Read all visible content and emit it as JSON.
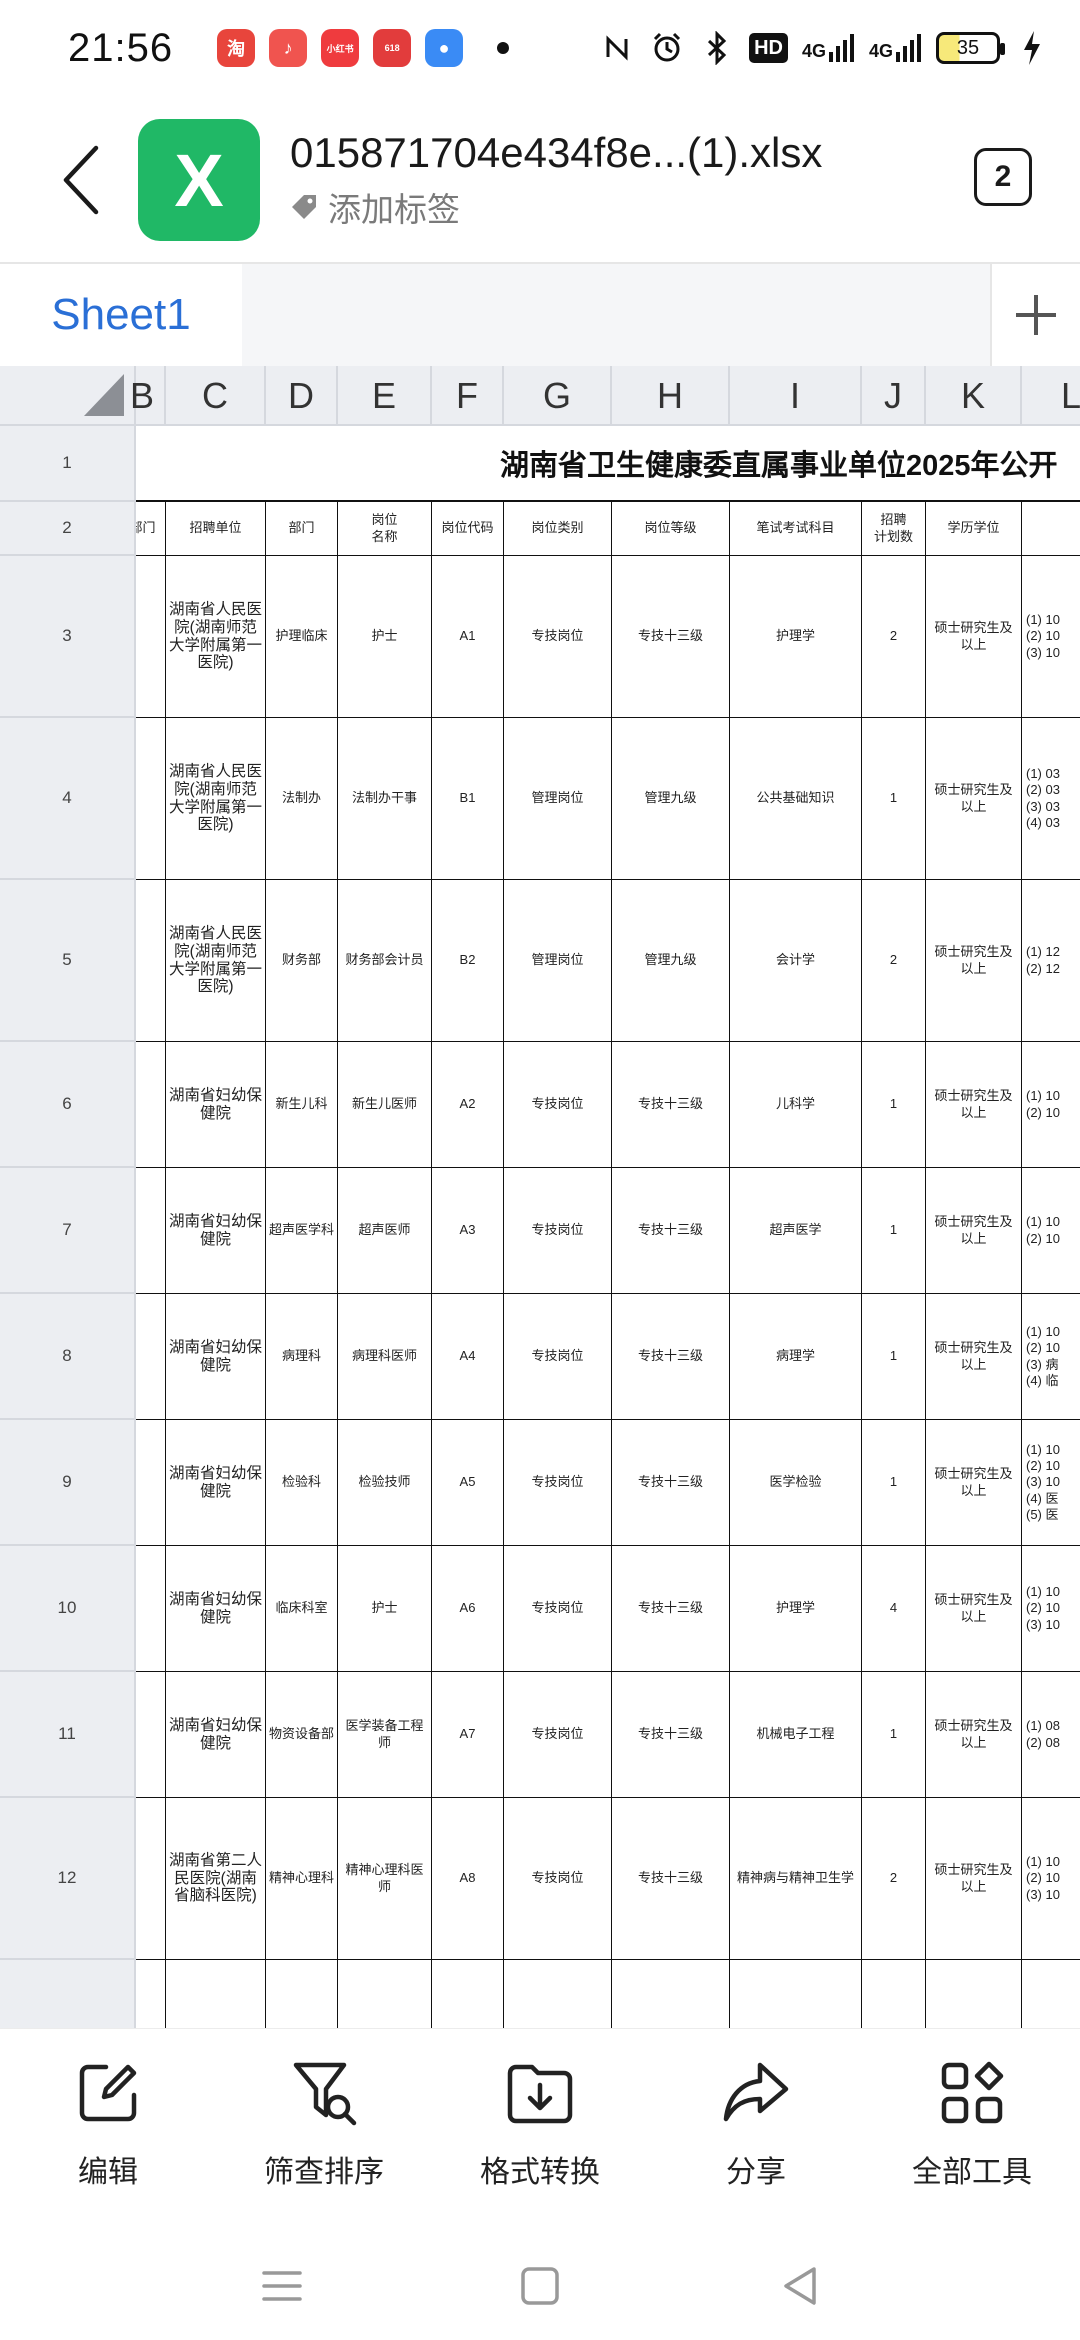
{
  "status_bar": {
    "time": "21:56",
    "apps": [
      {
        "icon": "taobao-app-icon",
        "glyph": "淘",
        "color": "#e8453c"
      },
      {
        "icon": "music-app-icon",
        "glyph": "♪",
        "color": "#f0544f"
      },
      {
        "icon": "xiaohongshu-app-icon",
        "glyph": "小红书",
        "color": "#ef3b3e"
      },
      {
        "icon": "jd-618-app-icon",
        "glyph": "618",
        "color": "#e23c3c"
      },
      {
        "icon": "blue-app-icon",
        "glyph": "●",
        "color": "#3a8bf5"
      }
    ],
    "hd_label": "HD",
    "signal1": "4G",
    "signal2": "4G",
    "battery": "35"
  },
  "header": {
    "file_title": "015871704e434f8e...(1).xlsx",
    "tag_label": "添加标签",
    "app_icon_letter": "X",
    "window_count": "2"
  },
  "sheet_tabs": {
    "active": "Sheet1"
  },
  "spreadsheet": {
    "columns": [
      "B",
      "C",
      "D",
      "E",
      "F",
      "G",
      "H",
      "I",
      "J",
      "K",
      "L"
    ],
    "row_numbers": [
      "1",
      "2",
      "3",
      "4",
      "5",
      "6",
      "7",
      "8",
      "9",
      "10",
      "11",
      "12",
      ""
    ],
    "title": "湖南省卫生健康委直属事业单位2025年公开",
    "headers": [
      "部门",
      "招聘单位",
      "部门",
      "岗位\n名称",
      "岗位代码",
      "岗位类别",
      "岗位等级",
      "笔试考试科目",
      "招聘\n计划数",
      "学历学位",
      ""
    ],
    "rows": [
      {
        "org": "湖南省人民医院(湖南师范大学附属第一医院)",
        "dept": "护理临床",
        "post": "护士",
        "code": "A1",
        "category": "专技岗位",
        "level": "专技十三级",
        "exam": "护理学",
        "count": "2",
        "degree": "硕士研究生及以上",
        "major": "(1) 10\n(2) 10\n(3) 10"
      },
      {
        "org": "湖南省人民医院(湖南师范大学附属第一医院)",
        "dept": "法制办",
        "post": "法制办干事",
        "code": "B1",
        "category": "管理岗位",
        "level": "管理九级",
        "exam": "公共基础知识",
        "count": "1",
        "degree": "硕士研究生及以上",
        "major": "(1) 03\n(2) 03\n(3) 03\n(4) 03"
      },
      {
        "org": "湖南省人民医院(湖南师范大学附属第一医院)",
        "dept": "财务部",
        "post": "财务部会计员",
        "code": "B2",
        "category": "管理岗位",
        "level": "管理九级",
        "exam": "会计学",
        "count": "2",
        "degree": "硕士研究生及以上",
        "major": "(1) 12\n(2) 12"
      },
      {
        "org": "湖南省妇幼保健院",
        "dept": "新生儿科",
        "post": "新生儿医师",
        "code": "A2",
        "category": "专技岗位",
        "level": "专技十三级",
        "exam": "儿科学",
        "count": "1",
        "degree": "硕士研究生及以上",
        "major": "(1) 10\n(2) 10"
      },
      {
        "org": "湖南省妇幼保健院",
        "dept": "超声医学科",
        "post": "超声医师",
        "code": "A3",
        "category": "专技岗位",
        "level": "专技十三级",
        "exam": "超声医学",
        "count": "1",
        "degree": "硕士研究生及以上",
        "major": "(1) 10\n(2) 10"
      },
      {
        "org": "湖南省妇幼保健院",
        "dept": "病理科",
        "post": "病理科医师",
        "code": "A4",
        "category": "专技岗位",
        "level": "专技十三级",
        "exam": "病理学",
        "count": "1",
        "degree": "硕士研究生及以上",
        "major": "(1) 10\n(2) 10\n(3) 病\n(4) 临"
      },
      {
        "org": "湖南省妇幼保健院",
        "dept": "检验科",
        "post": "检验技师",
        "code": "A5",
        "category": "专技岗位",
        "level": "专技十三级",
        "exam": "医学检验",
        "count": "1",
        "degree": "硕士研究生及以上",
        "major": "(1) 10\n(2) 10\n(3) 10\n(4) 医\n(5) 医"
      },
      {
        "org": "湖南省妇幼保健院",
        "dept": "临床科室",
        "post": "护士",
        "code": "A6",
        "category": "专技岗位",
        "level": "专技十三级",
        "exam": "护理学",
        "count": "4",
        "degree": "硕士研究生及以上",
        "major": "(1) 10\n(2) 10\n(3) 10"
      },
      {
        "org": "湖南省妇幼保健院",
        "dept": "物资设备部",
        "post": "医学装备工程师",
        "code": "A7",
        "category": "专技岗位",
        "level": "专技十三级",
        "exam": "机械电子工程",
        "count": "1",
        "degree": "硕士研究生及以上",
        "major": "(1) 08\n(2) 08"
      },
      {
        "org": "湖南省第二人民医院(湖南省脑科医院)",
        "dept": "精神心理科",
        "post": "精神心理科医师",
        "code": "A8",
        "category": "专技岗位",
        "level": "专技十三级",
        "exam": "精神病与精神卫生学",
        "count": "2",
        "degree": "硕士研究生及以上",
        "major": "(1) 10\n(2) 10\n(3) 10"
      }
    ]
  },
  "toolbar": {
    "edit": "编辑",
    "filter_sort": "筛查排序",
    "convert": "格式转换",
    "share": "分享",
    "all_tools": "全部工具"
  }
}
